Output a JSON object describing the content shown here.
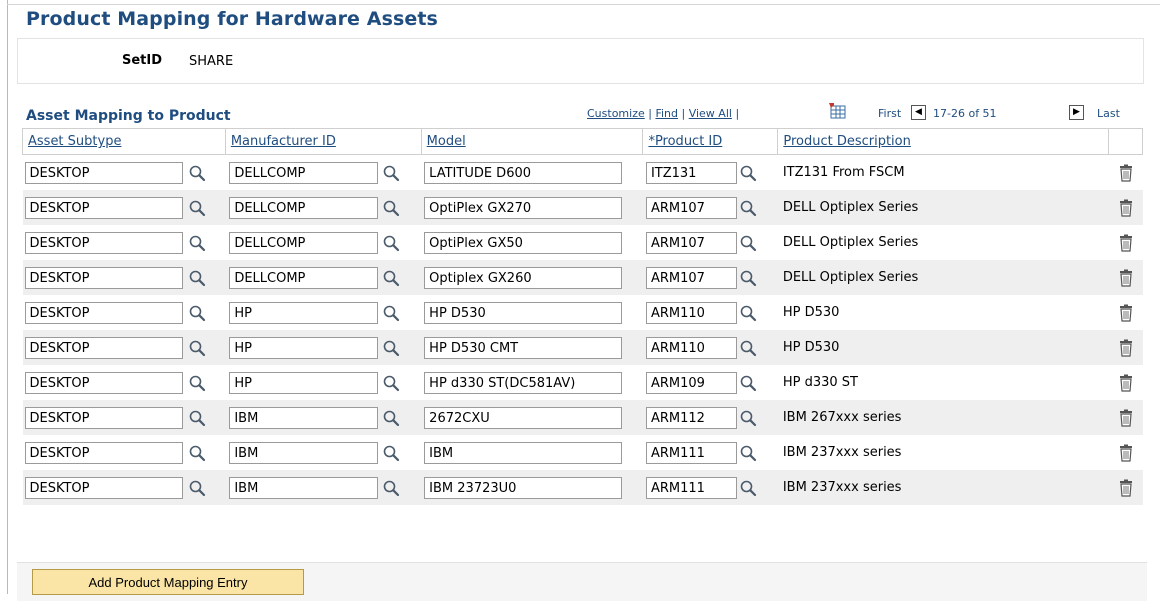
{
  "page": {
    "title": "Product Mapping for Hardware Assets"
  },
  "setid": {
    "label": "SetID",
    "value": "SHARE"
  },
  "grid": {
    "title": "Asset Mapping to Product",
    "nav": {
      "customize": "Customize",
      "find": "Find",
      "view_all": "View All",
      "first": "First",
      "range": "17-26 of 51",
      "last": "Last"
    },
    "columns": [
      "Asset Subtype",
      "Manufacturer ID",
      "Model",
      "*Product ID",
      "Product Description"
    ],
    "rows": [
      {
        "subtype": "DESKTOP",
        "manufacturer": "DELLCOMP",
        "model": "LATITUDE D600",
        "product_id": "ITZ131",
        "description": "ITZ131 From FSCM"
      },
      {
        "subtype": "DESKTOP",
        "manufacturer": "DELLCOMP",
        "model": "OptiPlex GX270",
        "product_id": "ARM107",
        "description": "DELL Optiplex Series"
      },
      {
        "subtype": "DESKTOP",
        "manufacturer": "DELLCOMP",
        "model": "OptiPlex GX50",
        "product_id": "ARM107",
        "description": "DELL Optiplex Series"
      },
      {
        "subtype": "DESKTOP",
        "manufacturer": "DELLCOMP",
        "model": "Optiplex GX260",
        "product_id": "ARM107",
        "description": "DELL Optiplex Series"
      },
      {
        "subtype": "DESKTOP",
        "manufacturer": "HP",
        "model": "HP D530",
        "product_id": "ARM110",
        "description": "HP D530"
      },
      {
        "subtype": "DESKTOP",
        "manufacturer": "HP",
        "model": "HP D530 CMT",
        "product_id": "ARM110",
        "description": "HP D530"
      },
      {
        "subtype": "DESKTOP",
        "manufacturer": "HP",
        "model": "HP d330 ST(DC581AV)",
        "product_id": "ARM109",
        "description": "HP d330 ST"
      },
      {
        "subtype": "DESKTOP",
        "manufacturer": "IBM",
        "model": "2672CXU",
        "product_id": "ARM112",
        "description": "IBM 267xxx series"
      },
      {
        "subtype": "DESKTOP",
        "manufacturer": "IBM",
        "model": "IBM",
        "product_id": "ARM111",
        "description": "IBM 237xxx series"
      },
      {
        "subtype": "DESKTOP",
        "manufacturer": "IBM",
        "model": "IBM 23723U0",
        "product_id": "ARM111",
        "description": "IBM 237xxx series"
      }
    ]
  },
  "actions": {
    "add_label": "Add Product Mapping Entry"
  }
}
